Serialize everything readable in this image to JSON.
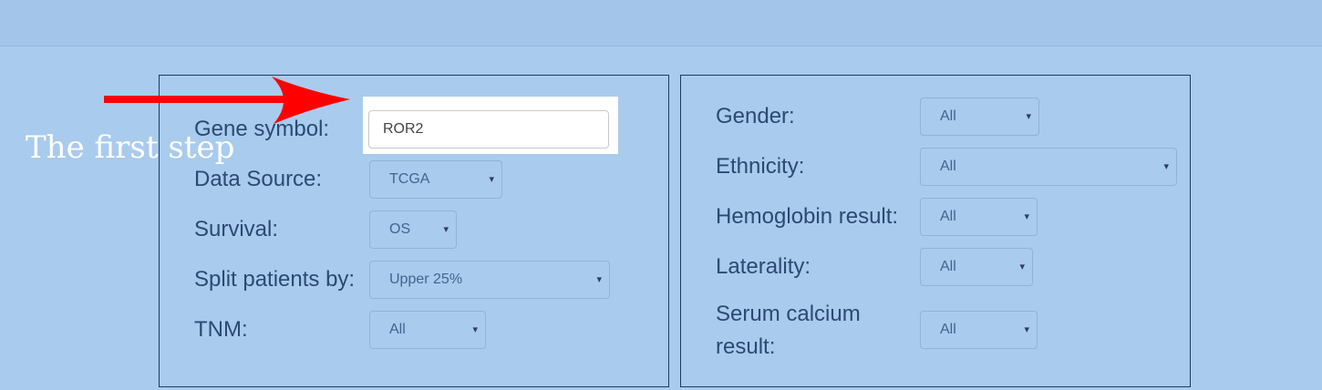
{
  "filters_left": {
    "gene_symbol": {
      "label": "Gene symbol:",
      "value": "ROR2"
    },
    "data_source": {
      "label": "Data Source:",
      "value": "TCGA"
    },
    "survival": {
      "label": "Survival:",
      "value": "OS"
    },
    "split_patients": {
      "label": "Split patients by:",
      "value": "Upper 25%"
    },
    "tnm": {
      "label": "TNM:",
      "value": "All"
    }
  },
  "filters_right": {
    "gender": {
      "label": "Gender:",
      "value": "All"
    },
    "ethnicity": {
      "label": "Ethnicity:",
      "value": "All"
    },
    "hemoglobin": {
      "label": "Hemoglobin result:",
      "value": "All"
    },
    "laterality": {
      "label": "Laterality:",
      "value": "All"
    },
    "serum_calcium": {
      "label": "Serum calcium result:",
      "value": "All"
    }
  },
  "annotation": {
    "text": "The first step",
    "arrow_color": "#ff0000"
  },
  "icons": {
    "dropdown_caret": "▾"
  },
  "colors": {
    "background": "#a9cbed",
    "label": "#2b4a72",
    "panel_border": "#1f3b66"
  }
}
